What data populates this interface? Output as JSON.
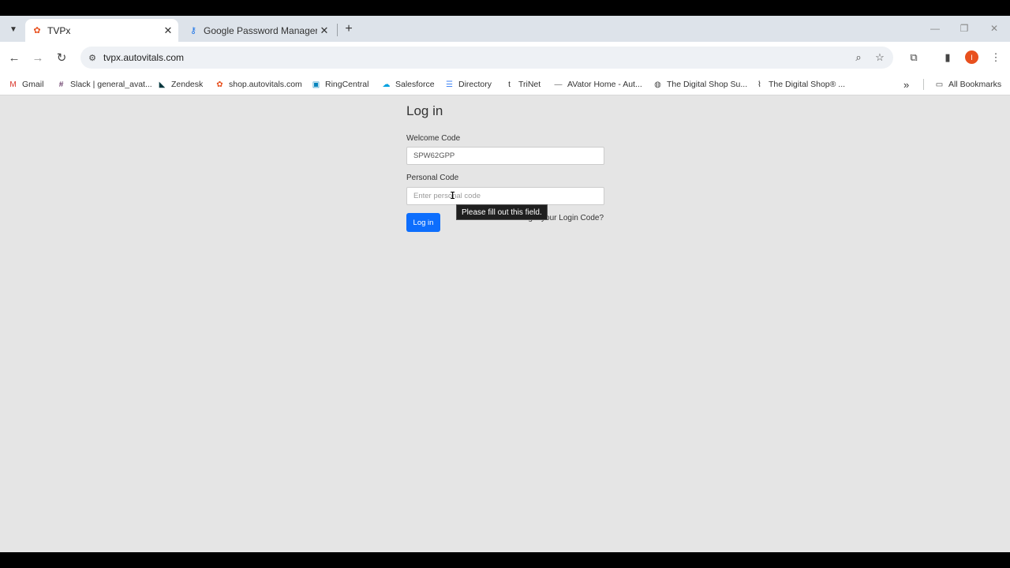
{
  "browser": {
    "tabs": [
      {
        "title": "TVPx",
        "active": true
      },
      {
        "title": "Google Password Manager",
        "active": false
      }
    ],
    "url": "tvpx.autovitals.com",
    "profile_initial": "I"
  },
  "bookmarks": {
    "items": [
      {
        "label": "Gmail",
        "icon": "gmail-icon"
      },
      {
        "label": "Slack | general_avat...",
        "icon": "slack-icon"
      },
      {
        "label": "Zendesk",
        "icon": "zendesk-icon"
      },
      {
        "label": "shop.autovitals.com",
        "icon": "autovitals-icon"
      },
      {
        "label": "RingCentral",
        "icon": "ringcentral-icon"
      },
      {
        "label": "Salesforce",
        "icon": "salesforce-icon"
      },
      {
        "label": "Directory",
        "icon": "document-icon"
      },
      {
        "label": "TriNet",
        "icon": "trinet-icon"
      },
      {
        "label": "AVator Home - Aut...",
        "icon": "dash-icon"
      },
      {
        "label": "The Digital Shop Su...",
        "icon": "globe-icon"
      },
      {
        "label": "The Digital Shop® ...",
        "icon": "pulse-icon"
      }
    ],
    "all_bookmarks": "All Bookmarks"
  },
  "login": {
    "title": "Log in",
    "welcome_label": "Welcome Code",
    "welcome_value": "SPW62GPP",
    "personal_label": "Personal Code",
    "personal_placeholder": "Enter personal code",
    "submit_label": "Log in",
    "forgot_text": "Forgot your Login Code?",
    "tooltip": "Please fill out this field."
  }
}
